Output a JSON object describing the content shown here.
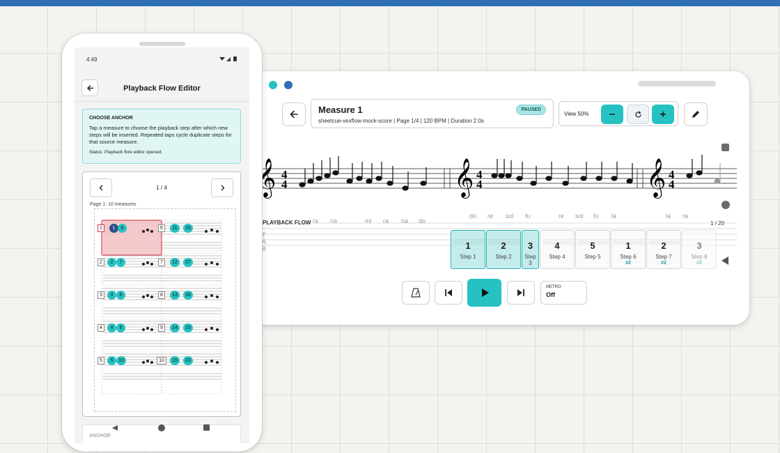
{
  "colors": {
    "accent": "#26c2c2",
    "top_bar": "#2f6fb5",
    "highlight_red": "#f3c5c8"
  },
  "tablet": {
    "header": {
      "back_icon": "arrow-left-icon",
      "measure_title": "Measure 1",
      "status_badge": "PAUSED",
      "meta": "sheetcue-vexflow-mock-score | Page 1/4 | 120 BPM | Duration 2.0s",
      "view_label": "View 50%",
      "zoom_out_icon": "minus-icon",
      "reset_icon": "refresh-icon",
      "zoom_in_icon": "plus-icon",
      "edit_icon": "pencil-icon"
    },
    "score": {
      "time_signature": "4/4",
      "tab_letters": [
        "T",
        "A",
        "B"
      ],
      "solfege_1": [
        "do",
        "re",
        "sol",
        "fu",
        "re",
        "sol",
        "fu",
        "la"
      ],
      "solfege_2": [
        "ra",
        "na",
        "mi",
        "ra",
        "na",
        "do"
      ],
      "solfege_3": [
        "la",
        "ra"
      ]
    },
    "flow": {
      "label": "PLAYBACK FLOW",
      "count": "1 / 20",
      "steps": [
        {
          "num": "1",
          "label": "Step 1",
          "dup": "",
          "highlight": true
        },
        {
          "num": "2",
          "label": "Step 2",
          "dup": "",
          "highlight": true
        },
        {
          "num": "3",
          "label": "Step 3",
          "dup": "",
          "highlight": true
        },
        {
          "num": "4",
          "label": "Step 4",
          "dup": "",
          "highlight": false
        },
        {
          "num": "5",
          "label": "Step 5",
          "dup": "",
          "highlight": false
        },
        {
          "num": "1",
          "label": "Step 6",
          "dup": "#2",
          "highlight": false
        },
        {
          "num": "2",
          "label": "Step 7",
          "dup": "#2",
          "highlight": false
        },
        {
          "num": "3",
          "label": "Step 8",
          "dup": "#2",
          "highlight": false
        }
      ]
    },
    "controls": {
      "metronome_icon": "metronome-icon",
      "prev_icon": "skip-back-icon",
      "play_icon": "play-icon",
      "next_icon": "skip-forward-icon",
      "metro_label": "METRO",
      "metro_value": "Off"
    }
  },
  "phone": {
    "status_time": "4:49",
    "title": "Playback Flow Editor",
    "anchor": {
      "heading": "CHOOSE ANCHOR",
      "text": "Tap a measure to choose the playback step after which new steps will be inserted. Repeated taps cycle duplicate steps for that source measure.",
      "status": "Status: Playback flow editor opened."
    },
    "pager": {
      "indicator": "1 / 4",
      "meta": "Page 1: 10 measures"
    },
    "measures": [
      {
        "num": "1",
        "badges": [
          "1",
          "6"
        ],
        "badges2": [
          "11",
          "16"
        ],
        "num2": "6"
      },
      {
        "num": "2",
        "badges": [
          "2",
          "7"
        ],
        "badges2": [
          "12",
          "17"
        ],
        "num2": "7"
      },
      {
        "num": "3",
        "badges": [
          "3",
          "8"
        ],
        "badges2": [
          "13",
          "18"
        ],
        "num2": "8"
      },
      {
        "num": "4",
        "badges": [
          "4",
          "9"
        ],
        "badges2": [
          "14",
          "19"
        ],
        "num2": "9"
      },
      {
        "num": "5",
        "badges": [
          "5",
          "10"
        ],
        "badges2": [
          "15",
          "20"
        ],
        "num2": "10"
      }
    ],
    "bottom_card": "ANCHOR"
  }
}
